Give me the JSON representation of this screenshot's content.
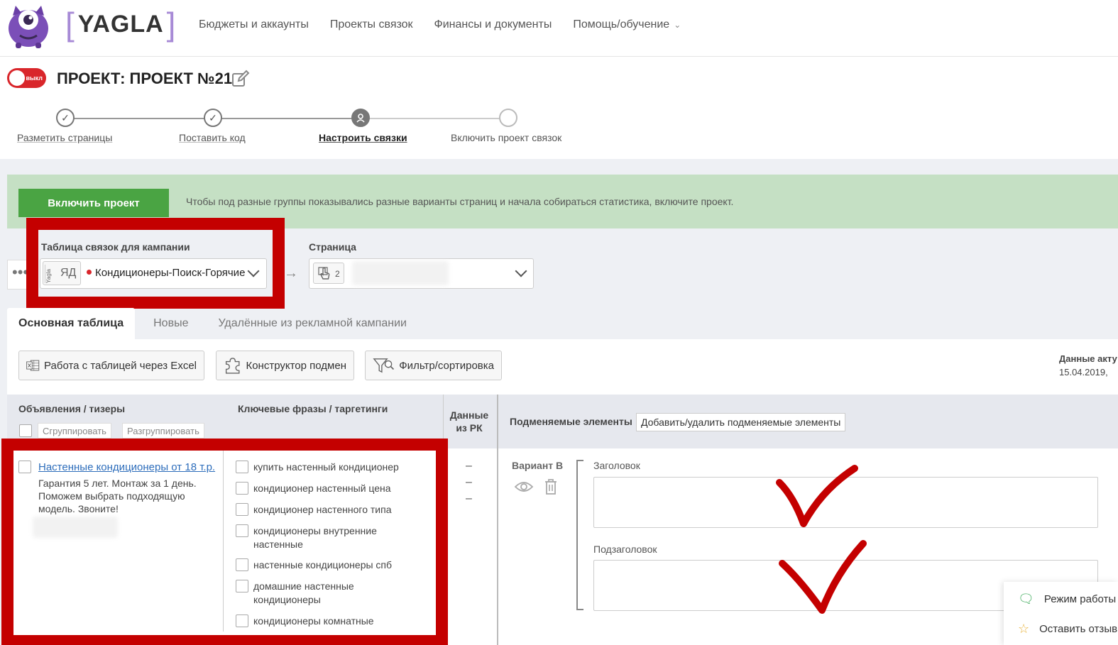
{
  "header": {
    "logo_text": "YAGLA",
    "nav": [
      {
        "label": "Бюджеты и аккаунты"
      },
      {
        "label": "Проекты связок"
      },
      {
        "label": "Финансы и документы"
      },
      {
        "label": "Помощь/обучение"
      }
    ]
  },
  "project": {
    "toggle_label": "выкл",
    "title": "ПРОЕКТ: ПРОЕКТ №21"
  },
  "steps": [
    {
      "label": "Разметить страницы",
      "state": "done"
    },
    {
      "label": "Поставить код",
      "state": "done"
    },
    {
      "label": "Настроить связки",
      "state": "active"
    },
    {
      "label": "Включить проект связок",
      "state": "pending"
    }
  ],
  "notice": {
    "button_label": "Включить проект",
    "text": "Чтобы под разные группы показывались разные варианты страниц и начала собираться статистика, включите проект."
  },
  "selectors": {
    "campaign_label": "Таблица связок для кампании",
    "badge_yagla": "Yagla",
    "badge_system": "ЯД",
    "campaign_name": "Кондиционеры-Поиск-Горячие",
    "page_label": "Страница",
    "page_count": "2"
  },
  "tabs": [
    {
      "label": "Основная таблица",
      "active": true
    },
    {
      "label": "Новые",
      "active": false
    },
    {
      "label": "Удалённые из рекламной кампании",
      "active": false
    }
  ],
  "toolbar": {
    "excel": "Работа с таблицей через Excel",
    "constructor": "Конструктор подмен",
    "filter": "Фильтр/сортировка",
    "data_label": "Данные акту",
    "data_date": "15.04.2019,"
  },
  "table": {
    "col_ads": "Объявления / тизеры",
    "col_keywords": "Ключевые фразы / таргетинги",
    "col_data": "Данные из РК",
    "col_data_l1": "Данные",
    "col_data_l2": "из РК",
    "group_btn": "Сгруппировать",
    "ungroup_btn": "Разгруппировать",
    "replace_label": "Подменяемые элементы",
    "replace_btn": "Добавить/удалить подменяемые элементы",
    "ad": {
      "title": "Настенные кондиционеры от 18 т.р.",
      "text": "Гарантия 5 лет. Монтаж за 1 день. Поможем выбрать подходящую модель. Звоните!"
    },
    "keywords": [
      "купить настенный кондиционер",
      "кондиционер настенный цена",
      "кондиционер настенного типа",
      "кондиционеры внутренние настенные",
      "настенные кондиционеры спб",
      "домашние настенные кондиционеры",
      "кондиционеры комнатные"
    ],
    "dashes": [
      "–",
      "–",
      "–"
    ],
    "variant_label": "Вариант В",
    "field_title": "Заголовок",
    "field_subtitle": "Подзаголовок"
  },
  "widget": {
    "item1": "Режим работы",
    "item2": "Оставить отзыв"
  },
  "colors": {
    "brand_purple": "#a78ad6",
    "toggle_red": "#d9262b",
    "enable_green": "#4aa443",
    "notice_bg": "#c5e0c4",
    "annotation_red": "#c40000",
    "link_blue": "#2d6dbb"
  }
}
